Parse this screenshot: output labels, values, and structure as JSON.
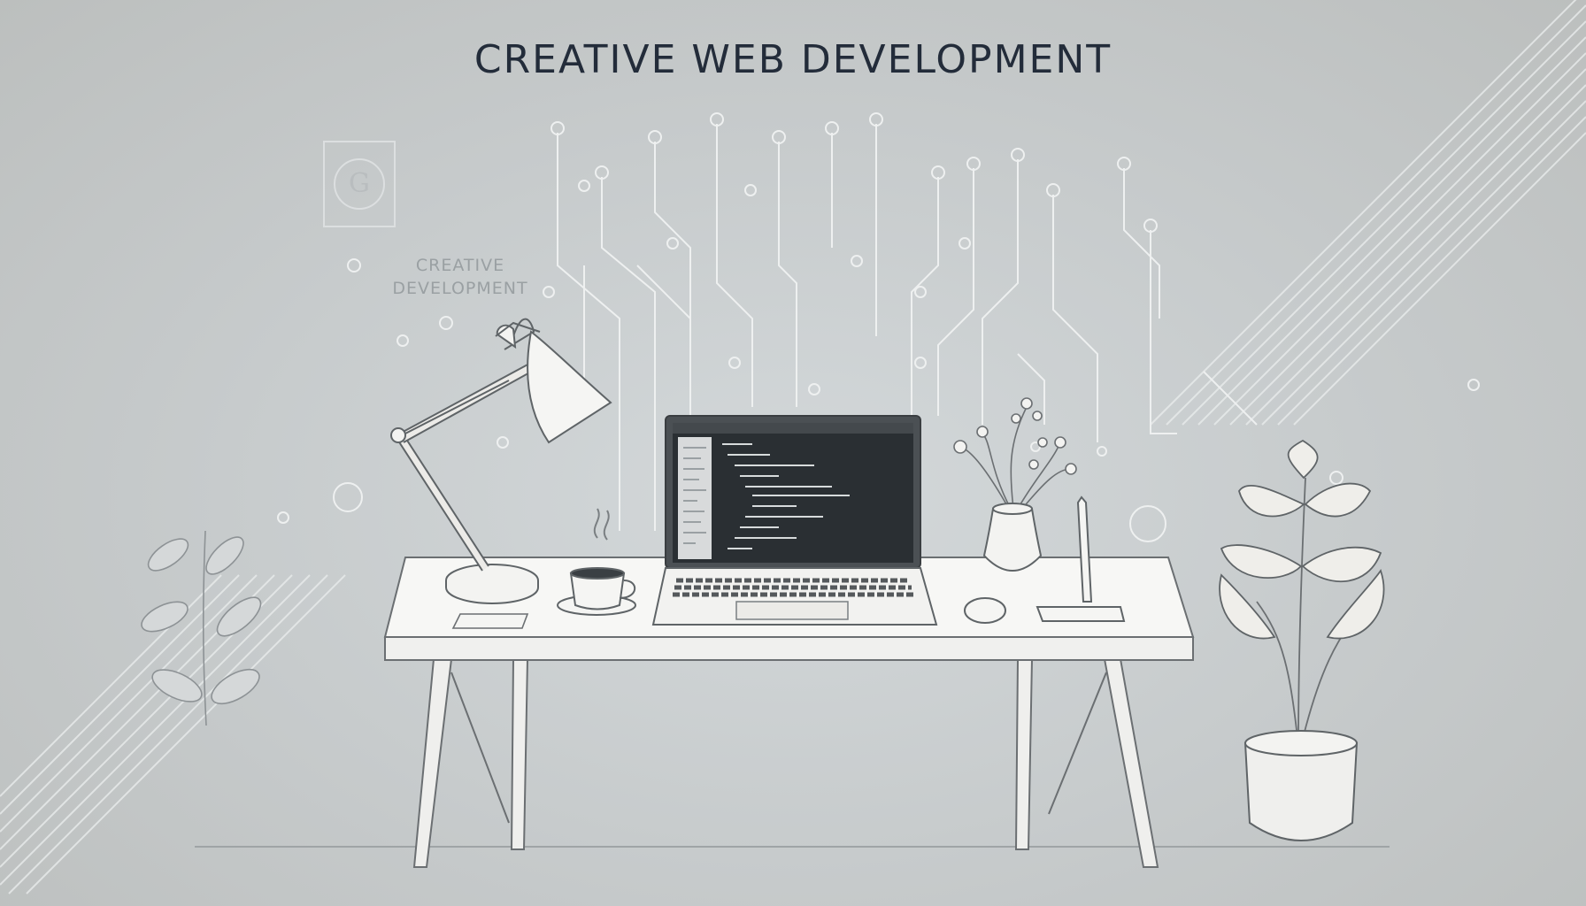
{
  "headline": "CREATIVE WEB DEVELOPMENT",
  "side_label": {
    "line1": "CREATIVE",
    "line2": "DEVELOPMENT"
  },
  "badge_letter": "G",
  "colors": {
    "background": "#c6cacb",
    "headline": "#232c3a",
    "line_art": "#eef0f0",
    "outline": "#6b6f72",
    "desk": "#f7f7f5",
    "screen": "#2a2f33"
  },
  "icons": [
    "circuit-lines",
    "desk-lamp",
    "laptop",
    "coffee-cup",
    "flower-vase",
    "mouse",
    "pen",
    "notepad",
    "potted-plant",
    "leaf-branch"
  ]
}
